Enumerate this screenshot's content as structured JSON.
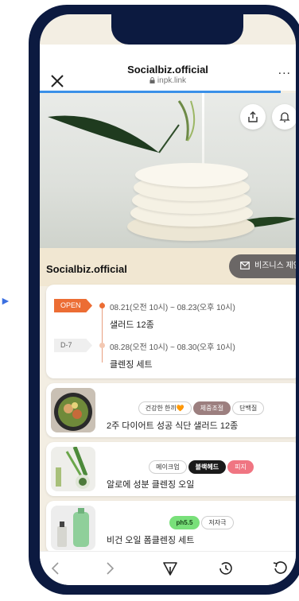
{
  "browser": {
    "title": "Socialbiz.official",
    "url": "inpk.link",
    "more": "..."
  },
  "business": {
    "name": "Socialbiz.official",
    "proposal_button": "비즈니스 제안"
  },
  "schedule": [
    {
      "tag": "OPEN",
      "range": "08.21(오전 10시) ~ 08.23(오후 10시)",
      "item": "샐러드 12종"
    },
    {
      "tag": "D-7",
      "range": "08.28(오전 10시) ~ 08.30(오후 10시)",
      "item": "클렌징 세트"
    }
  ],
  "products": [
    {
      "chips": [
        "건강한 한끼🧡",
        "체중조절",
        "단백질"
      ],
      "title": "2주 다이어트 성공 식단 샐러드 12종"
    },
    {
      "chips": [
        "메이크업",
        "블랙헤드",
        "피지"
      ],
      "title": "알로에 성분 클렌징 오일"
    },
    {
      "chips": [
        "ph5.5",
        "저자극"
      ],
      "title": "비건 오일 폼클렌징 세트"
    }
  ],
  "colors": {
    "accent_orange": "#ec6d34",
    "progress_blue": "#3a90e8",
    "phone_frame": "#0c1a40",
    "business_bar": "#f1e7d2"
  },
  "icons": {
    "close": "close-icon",
    "lock": "lock-icon",
    "share": "share-icon",
    "bell": "bell-icon",
    "mail": "mail-icon",
    "back": "back-arrow-icon",
    "forward": "forward-arrow-icon",
    "send": "send-icon",
    "history": "history-icon",
    "reload": "reload-icon"
  }
}
